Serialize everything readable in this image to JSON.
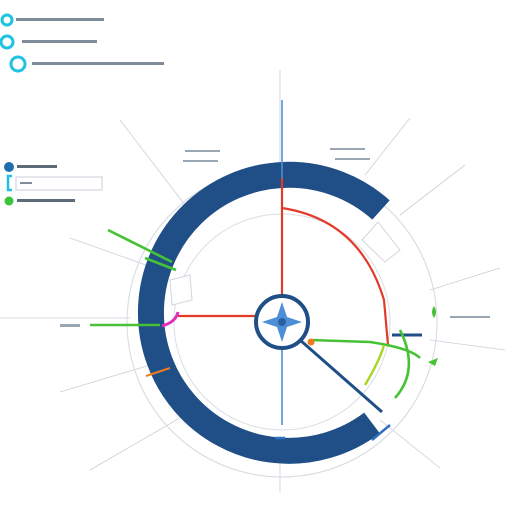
{
  "colors": {
    "ring": "#1f4f86",
    "ring_light": "#d9e3ee",
    "red_line": "#e23b2a",
    "green_line": "#46c234",
    "lime_line": "#a7d51b",
    "magenta_line": "#e02fbf",
    "orange_line": "#f07a1f",
    "cyan_dot": "#1fc2e2",
    "blue_dot": "#1f6fb0",
    "green_dot": "#3cc43a",
    "center_icon": "#4d8fd6",
    "grey_line": "#b8c2cc"
  },
  "icons": {
    "center": "compass-star-icon"
  },
  "legend_top": [
    {
      "marker": "cyan-ring-marker",
      "text_placeholder": ""
    },
    {
      "marker": "cyan-ring-marker",
      "text_placeholder": ""
    },
    {
      "marker": "cyan-ring-marker",
      "text_placeholder": ""
    }
  ],
  "legend_mid": [
    {
      "marker": "blue-dot-marker"
    },
    {
      "marker": "cyan-bracket-marker"
    },
    {
      "marker": "green-dot-marker"
    }
  ]
}
